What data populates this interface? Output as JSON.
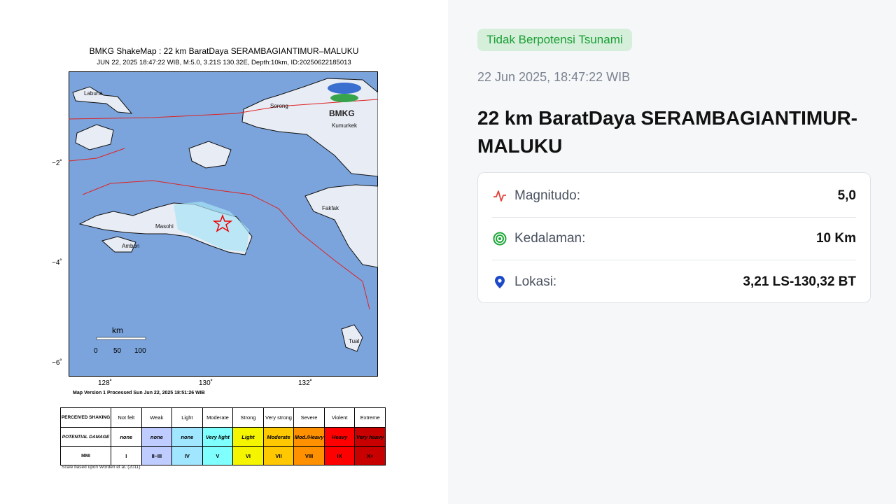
{
  "shakemap": {
    "title": "BMKG ShakeMap : 22 km BaratDaya SERAMBAGIANTIMUR–MALUKU",
    "subtitle": "JUN 22, 2025 18:47:22 WIB, M:5.0, 3.21S 130.32E, Depth:10km, ID:20250622185013",
    "y_ticks": [
      "−2˚",
      "−4˚",
      "−6˚"
    ],
    "x_ticks": [
      "128˚",
      "130˚",
      "132˚"
    ],
    "places": [
      "Labuha",
      "Sorong",
      "Kumurkek",
      "Fakfak",
      "Masohi",
      "Ambon",
      "Tual"
    ],
    "logo_text": "BMKG",
    "scale_bar": {
      "unit": "km",
      "ticks": [
        "0",
        "50",
        "100"
      ]
    },
    "map_version": "Map Version 1 Processed Sun Jun 22, 2025 18:51:26 WIB",
    "scale_note": "Scale based upon Worden et al. (2011)",
    "mmi_table": {
      "row_headers": [
        "PERCEIVED SHAKING",
        "POTENTIAL DAMAGE",
        "MMI"
      ],
      "shaking": [
        "Not felt",
        "Weak",
        "Light",
        "Moderate",
        "Strong",
        "Very strong",
        "Severe",
        "Violent",
        "Extreme"
      ],
      "damage": [
        "none",
        "none",
        "none",
        "Very light",
        "Light",
        "Moderate",
        "Mod./Heavy",
        "Heavy",
        "Very heavy"
      ],
      "mmi": [
        "I",
        "II–III",
        "IV",
        "V",
        "VI",
        "VII",
        "VIII",
        "IX",
        "X+"
      ],
      "colors": [
        "#ffffff",
        "#bfccff",
        "#a0e6ff",
        "#80ffff",
        "#f5f500",
        "#ffc800",
        "#ff9100",
        "#ff0000",
        "#c80000"
      ]
    }
  },
  "info": {
    "tsunami_badge": "Tidak Berpotensi Tsunami",
    "datetime": "22 Jun 2025, 18:47:22 WIB",
    "location_title": "22 km BaratDaya SERAMBAGIANTIMUR-MALUKU",
    "magnitude_label": "Magnitudo:",
    "magnitude_value": "5,0",
    "depth_label": "Kedalaman:",
    "depth_value": "10 Km",
    "location_label": "Lokasi:",
    "location_value": "3,21 LS-130,32 BT",
    "colors": {
      "badge_bg": "#d5efda",
      "badge_text": "#1a9e34",
      "magnitude_icon": "#e0443c",
      "depth_icon": "#1fa83a",
      "location_icon": "#1c49c9"
    },
    "icons": [
      "pulse-icon",
      "target-icon",
      "map-pin-icon"
    ]
  }
}
